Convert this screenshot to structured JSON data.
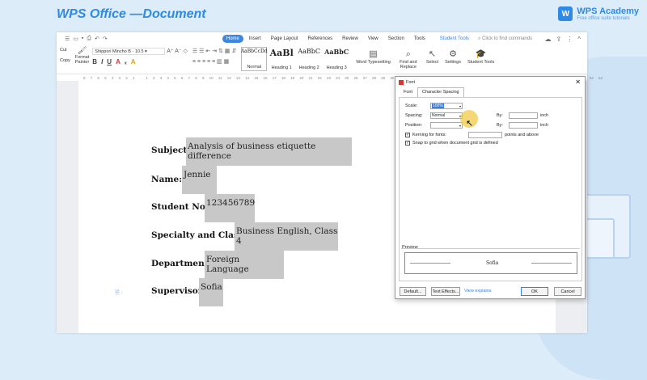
{
  "brand": {
    "title": "WPS Office —Document",
    "academy": "WPS Academy",
    "academy_sub": "Free office suite tutorials",
    "logo": "W"
  },
  "tabs": [
    "Home",
    "Insert",
    "Page Layout",
    "References",
    "Review",
    "View",
    "Section",
    "Tools"
  ],
  "student_tab": "Student Tools",
  "find_commands": "Click to find commands",
  "ribbon": {
    "cut": "Cut",
    "copy": "Copy",
    "format_painter": "Format\nPainter",
    "font_name": "Shippori Mincho B",
    "font_size": "10.5",
    "styles": [
      {
        "preview": "AaBbCcDd",
        "label": "Normal"
      },
      {
        "preview": "AaBl",
        "label": "Heading 1"
      },
      {
        "preview": "AaBbC",
        "label": "Heading 2"
      },
      {
        "preview": "AaBbC",
        "label": "Heading 3"
      }
    ],
    "word_typesetting": "Word Typesetting",
    "find_replace": "Find and Replace",
    "select": "Select",
    "settings": "Settings",
    "student_tools": "Student Tools"
  },
  "ruler": [
    "8",
    "7",
    "6",
    "5",
    "4",
    "3",
    "2",
    "1",
    "",
    "1",
    "2",
    "3",
    "4",
    "5",
    "6",
    "7",
    "8",
    "9",
    "10",
    "11",
    "12",
    "13",
    "14",
    "15",
    "16",
    "17",
    "18",
    "19",
    "20",
    "21",
    "22",
    "23",
    "24",
    "25",
    "26",
    "27",
    "28",
    "29",
    "30",
    "31",
    "32",
    "33",
    "34",
    "35",
    "36",
    "37",
    "38",
    "39",
    "40",
    "41",
    "42",
    "43",
    "44",
    "45",
    "46",
    "47",
    "48",
    "49",
    "50",
    "51",
    "52",
    "53"
  ],
  "document": {
    "fields": [
      {
        "label": "Subject:",
        "value": "Analysis of  business etiquette difference"
      },
      {
        "label": "Name:",
        "value": "Jennie"
      },
      {
        "label": "Student No.:",
        "value": "123456789"
      },
      {
        "label": "Specialty and Class:",
        "value": "Business English, Class 4"
      },
      {
        "label": "Department",
        "value": "Foreign Language"
      },
      {
        "label": "Supervisor:",
        "value": "Sofia"
      }
    ],
    "colon": ":"
  },
  "dialog": {
    "title": "Font",
    "tabs": [
      "Font",
      "Character Spacing"
    ],
    "scale_label": "Scale:",
    "scale_value": "100%",
    "spacing_label": "Spacing:",
    "spacing_value": "Normal",
    "position_label": "Position:",
    "by_label": "By:",
    "unit": "inch",
    "kerning_label": "Kerning for fonts:",
    "kerning_suffix": "points and above",
    "snap_label": "Snap to grid when document grid is defined",
    "preview_label": "Preview",
    "preview_text": "Sofia",
    "default_btn": "Default...",
    "text_effects_btn": "Text Effects...",
    "view_explains": "View explains",
    "ok_btn": "OK",
    "cancel_btn": "Cancel",
    "close": "✕"
  },
  "colors": {
    "accent": "#3b87e3",
    "brand": "#2f8ae6",
    "highlight": "#c8c8c8"
  }
}
